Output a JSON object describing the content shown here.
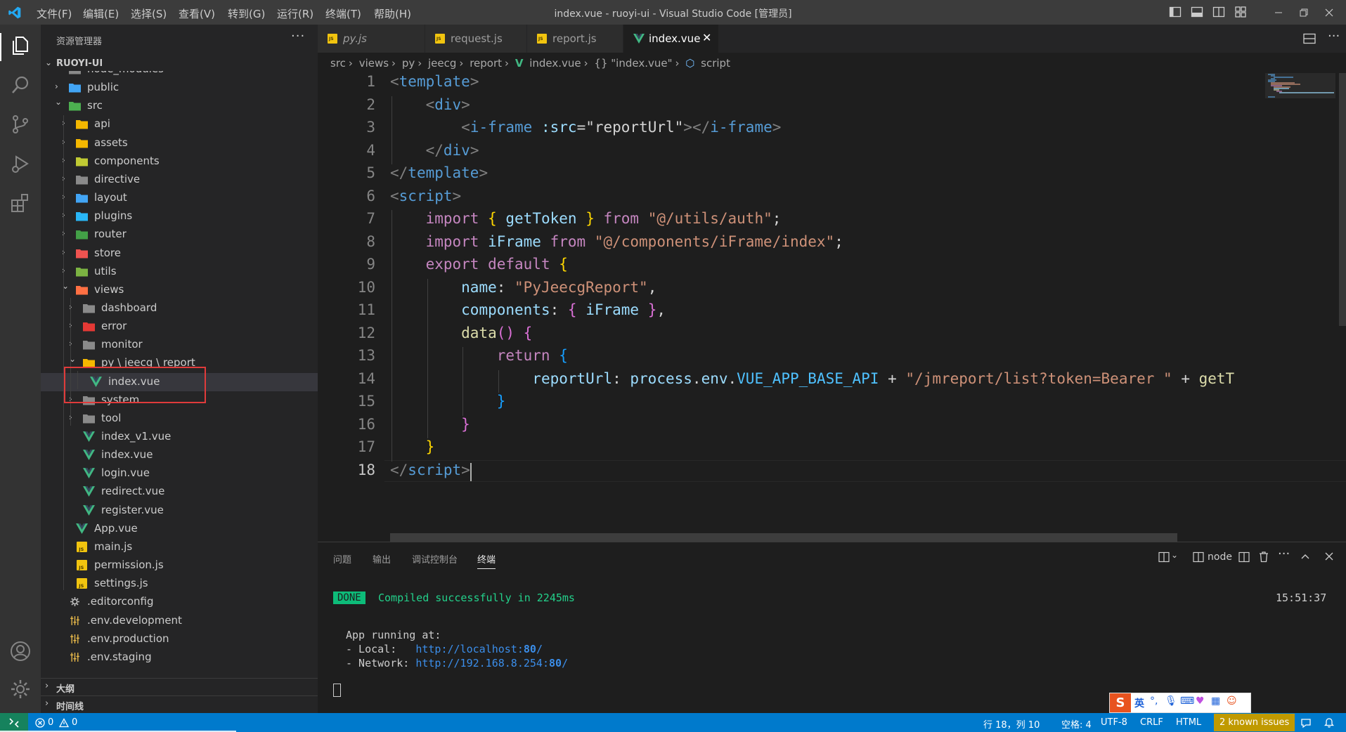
{
  "window": {
    "title": "index.vue - ruoyi-ui - Visual Studio Code [管理员]",
    "menu": [
      "文件(F)",
      "编辑(E)",
      "选择(S)",
      "查看(V)",
      "转到(G)",
      "运行(R)",
      "终端(T)",
      "帮助(H)"
    ]
  },
  "sidebar": {
    "title": "资源管理器",
    "more": "···",
    "section": "RUOYI-UI",
    "tree": [
      {
        "label": "node_modules",
        "icon": "folder-icon",
        "expanded": false
      },
      {
        "label": "public",
        "icon": "folder-public-icon",
        "expanded": false
      },
      {
        "label": "src",
        "icon": "folder-src-icon",
        "expanded": true
      },
      {
        "label": "api",
        "icon": "folder-api-icon",
        "expanded": false
      },
      {
        "label": "assets",
        "icon": "folder-assets-icon",
        "expanded": false
      },
      {
        "label": "components",
        "icon": "folder-components-icon",
        "expanded": false
      },
      {
        "label": "directive",
        "icon": "folder-icon",
        "expanded": false
      },
      {
        "label": "layout",
        "icon": "folder-layout-icon",
        "expanded": false
      },
      {
        "label": "plugins",
        "icon": "folder-plugins-icon",
        "expanded": false
      },
      {
        "label": "router",
        "icon": "folder-router-icon",
        "expanded": false
      },
      {
        "label": "store",
        "icon": "folder-store-icon",
        "expanded": false
      },
      {
        "label": "utils",
        "icon": "folder-utils-icon",
        "expanded": false
      },
      {
        "label": "views",
        "icon": "folder-views-icon",
        "expanded": true
      },
      {
        "label": "dashboard",
        "icon": "folder-icon",
        "expanded": false
      },
      {
        "label": "error",
        "icon": "folder-error-icon",
        "expanded": false
      },
      {
        "label": "monitor",
        "icon": "folder-icon",
        "expanded": false
      },
      {
        "label": "py \\ jeecg \\ report",
        "icon": "folder-open-icon",
        "expanded": true
      },
      {
        "label": "index.vue",
        "icon": "vue-icon"
      },
      {
        "label": "system",
        "icon": "folder-icon",
        "expanded": false
      },
      {
        "label": "tool",
        "icon": "folder-icon",
        "expanded": false
      },
      {
        "label": "index_v1.vue",
        "icon": "vue-icon"
      },
      {
        "label": "index.vue",
        "icon": "vue-icon"
      },
      {
        "label": "login.vue",
        "icon": "vue-icon"
      },
      {
        "label": "redirect.vue",
        "icon": "vue-icon"
      },
      {
        "label": "register.vue",
        "icon": "vue-icon"
      },
      {
        "label": "App.vue",
        "icon": "vue-icon"
      },
      {
        "label": "main.js",
        "icon": "js-icon"
      },
      {
        "label": "permission.js",
        "icon": "js-icon"
      },
      {
        "label": "settings.js",
        "icon": "js-icon"
      },
      {
        "label": ".editorconfig",
        "icon": "gear-icon"
      },
      {
        "label": ".env.development",
        "icon": "env-icon"
      },
      {
        "label": ".env.production",
        "icon": "env-icon"
      },
      {
        "label": ".env.staging",
        "icon": "env-icon"
      }
    ],
    "outline": "大纲",
    "timeline": "时间线"
  },
  "tabs": [
    {
      "label": "py.js",
      "icon": "js-icon",
      "active": false
    },
    {
      "label": "request.js",
      "icon": "js-icon",
      "active": false
    },
    {
      "label": "report.js",
      "icon": "js-icon",
      "active": false
    },
    {
      "label": "index.vue",
      "icon": "vue-icon",
      "active": true
    }
  ],
  "breadcrumb": [
    "src",
    "views",
    "py",
    "jeecg",
    "report",
    "index.vue",
    "{} \"index.vue\"",
    "script"
  ],
  "editor": {
    "line_numbers": [
      "1",
      "2",
      "3",
      "4",
      "5",
      "6",
      "7",
      "8",
      "9",
      "10",
      "11",
      "12",
      "13",
      "14",
      "15",
      "16",
      "17",
      "18"
    ],
    "current_line": "18",
    "lines": [
      [
        {
          "t": "<",
          "c": "t-br"
        },
        {
          "t": "template",
          "c": "t-tag"
        },
        {
          "t": ">",
          "c": "t-br"
        }
      ],
      [
        {
          "t": "    "
        },
        {
          "t": "<",
          "c": "t-br"
        },
        {
          "t": "div",
          "c": "t-tag"
        },
        {
          "t": ">",
          "c": "t-br"
        }
      ],
      [
        {
          "t": "        "
        },
        {
          "t": "<",
          "c": "t-br"
        },
        {
          "t": "i-frame",
          "c": "t-tag"
        },
        {
          "t": " "
        },
        {
          "t": ":src",
          "c": "t-attr"
        },
        {
          "t": "=",
          "c": "t-plain"
        },
        {
          "t": "\"reportUrl\"",
          "c": "t-plain"
        },
        {
          "t": "></",
          "c": "t-br"
        },
        {
          "t": "i-frame",
          "c": "t-tag"
        },
        {
          "t": ">",
          "c": "t-br"
        }
      ],
      [
        {
          "t": "    "
        },
        {
          "t": "</",
          "c": "t-br"
        },
        {
          "t": "div",
          "c": "t-tag"
        },
        {
          "t": ">",
          "c": "t-br"
        }
      ],
      [
        {
          "t": "</",
          "c": "t-br"
        },
        {
          "t": "template",
          "c": "t-tag"
        },
        {
          "t": ">",
          "c": "t-br"
        }
      ],
      [
        {
          "t": "<",
          "c": "t-br"
        },
        {
          "t": "script",
          "c": "t-tag"
        },
        {
          "t": ">",
          "c": "t-br"
        }
      ],
      [
        {
          "t": "    "
        },
        {
          "t": "import",
          "c": "t-kw"
        },
        {
          "t": " "
        },
        {
          "t": "{",
          "c": "t-y"
        },
        {
          "t": " getToken ",
          "c": "t-var"
        },
        {
          "t": "}",
          "c": "t-y"
        },
        {
          "t": " "
        },
        {
          "t": "from",
          "c": "t-kw"
        },
        {
          "t": " "
        },
        {
          "t": "\"@/utils/auth\"",
          "c": "t-str"
        },
        {
          "t": ";",
          "c": "t-plain"
        }
      ],
      [
        {
          "t": "    "
        },
        {
          "t": "import",
          "c": "t-kw"
        },
        {
          "t": " iFrame ",
          "c": "t-var"
        },
        {
          "t": "from",
          "c": "t-kw"
        },
        {
          "t": " "
        },
        {
          "t": "\"@/components/iFrame/index\"",
          "c": "t-str"
        },
        {
          "t": ";",
          "c": "t-plain"
        }
      ],
      [
        {
          "t": "    "
        },
        {
          "t": "export",
          "c": "t-kw"
        },
        {
          "t": " "
        },
        {
          "t": "default",
          "c": "t-kw"
        },
        {
          "t": " "
        },
        {
          "t": "{",
          "c": "t-y"
        }
      ],
      [
        {
          "t": "        "
        },
        {
          "t": "name",
          "c": "t-var"
        },
        {
          "t": ": ",
          "c": "t-plain"
        },
        {
          "t": "\"PyJeecgReport\"",
          "c": "t-str"
        },
        {
          "t": ",",
          "c": "t-plain"
        }
      ],
      [
        {
          "t": "        "
        },
        {
          "t": "components",
          "c": "t-var"
        },
        {
          "t": ": ",
          "c": "t-plain"
        },
        {
          "t": "{",
          "c": "t-p"
        },
        {
          "t": " iFrame ",
          "c": "t-var"
        },
        {
          "t": "}",
          "c": "t-p"
        },
        {
          "t": ",",
          "c": "t-plain"
        }
      ],
      [
        {
          "t": "        "
        },
        {
          "t": "data",
          "c": "t-fn"
        },
        {
          "t": "() ",
          "c": "t-p"
        },
        {
          "t": "{",
          "c": "t-p"
        }
      ],
      [
        {
          "t": "            "
        },
        {
          "t": "return",
          "c": "t-kw"
        },
        {
          "t": " "
        },
        {
          "t": "{",
          "c": "t-b"
        }
      ],
      [
        {
          "t": "                "
        },
        {
          "t": "reportUrl",
          "c": "t-var"
        },
        {
          "t": ": ",
          "c": "t-plain"
        },
        {
          "t": "process",
          "c": "t-var"
        },
        {
          "t": ".",
          "c": "t-plain"
        },
        {
          "t": "env",
          "c": "t-var"
        },
        {
          "t": ".",
          "c": "t-plain"
        },
        {
          "t": "VUE_APP_BASE_API",
          "c": "t-const"
        },
        {
          "t": " + ",
          "c": "t-plain"
        },
        {
          "t": "\"/jmreport/list?token=Bearer \"",
          "c": "t-str"
        },
        {
          "t": " + ",
          "c": "t-plain"
        },
        {
          "t": "getT",
          "c": "t-fn"
        }
      ],
      [
        {
          "t": "            "
        },
        {
          "t": "}",
          "c": "t-b"
        }
      ],
      [
        {
          "t": "        "
        },
        {
          "t": "}",
          "c": "t-p"
        }
      ],
      [
        {
          "t": "    "
        },
        {
          "t": "}",
          "c": "t-y"
        }
      ],
      [
        {
          "t": "</",
          "c": "t-br"
        },
        {
          "t": "script",
          "c": "t-tag"
        },
        {
          "t": ">",
          "c": "t-br"
        }
      ]
    ]
  },
  "panel": {
    "tabs": [
      "问题",
      "输出",
      "调试控制台",
      "终端"
    ],
    "active_tab": "终端",
    "terminal_name": "node",
    "done": "DONE",
    "compiled": "Compiled successfully in 2245ms",
    "time": "15:51:37",
    "app_running": "App running at:",
    "local_label": "- Local:   ",
    "local_url": "http://localhost:",
    "local_port": "80",
    "network_label": "- Network: ",
    "network_url": "http://192.168.8.254:",
    "network_port": "80",
    "slash": "/"
  },
  "ime": {
    "lang": "英"
  },
  "statusbar": {
    "errors": "0",
    "warnings": "0",
    "position": "行 18，列 10",
    "spaces": "空格: 4",
    "encoding": "UTF-8",
    "eol": "CRLF",
    "language": "HTML",
    "issues": "2 known issues"
  },
  "colors": {
    "accent": "#007acc",
    "highlight_box": "#e03b3b",
    "done_badge": "#0dbc79",
    "issues_badge": "#c09a00"
  }
}
